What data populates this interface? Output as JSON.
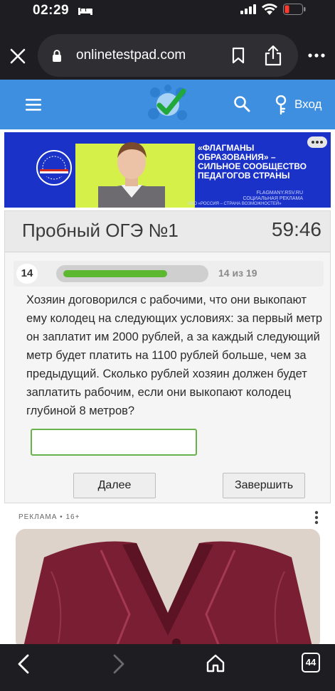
{
  "status_bar": {
    "time": "02:29"
  },
  "browser": {
    "url": "onlinetestpad.com",
    "tab_count": "44"
  },
  "site_header": {
    "login_label": "Вход"
  },
  "banner": {
    "headline": "«Флагманы образования» – сильное сообщество педагогов страны",
    "subtext": "FLAGMANY.RSV.RU\nСОЦИАЛЬНАЯ РЕКЛАМА",
    "footer": "АНО «РОССИЯ – СТРАНА ВОЗМОЖНОСТЕЙ»"
  },
  "test": {
    "title": "Пробный ОГЭ №1",
    "timer": "59:46",
    "question_number": "14",
    "progress_text": "14 из 19",
    "progress_current": 14,
    "progress_total": 19,
    "question_text": "Хозяин договорился с рабочими, что они выкопают ему колодец на  следующих условиях: за первый метр он заплатит им 2000 рублей, а за  каждый следующий метр будет платить на 1100 рублей больше, чем за  предыдущий. Сколько рублей хозяин должен будет заплатить рабочим,  если они выкопают колодец глубиной 8 метров?",
    "answer_value": "",
    "next_label": "Далее",
    "finish_label": "Завершить"
  },
  "ad": {
    "label": "РЕКЛАМА • 16+"
  },
  "colors": {
    "header_blue": "#3f8fe0",
    "progress_green": "#5cb82e",
    "banner_blue": "#1b32c9",
    "ad_burgundy": "#7a1f33"
  }
}
